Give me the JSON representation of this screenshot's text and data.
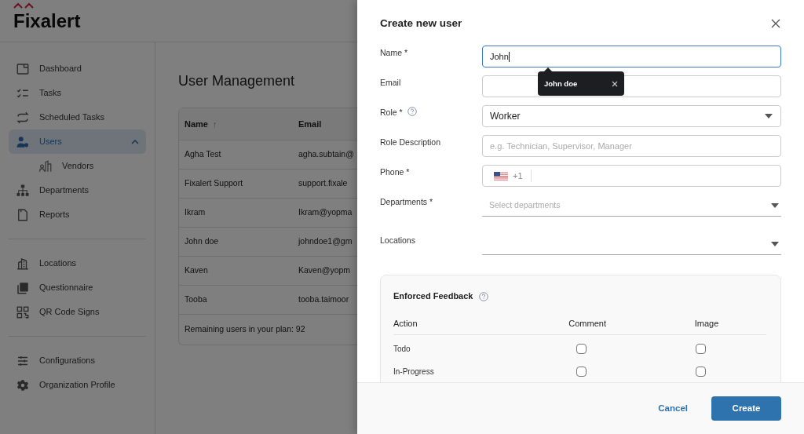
{
  "app": {
    "logo": "Fixalert"
  },
  "sidebar": {
    "items": [
      {
        "label": "Dashboard",
        "selected": false
      },
      {
        "label": "Tasks",
        "selected": false
      },
      {
        "label": "Scheduled Tasks",
        "selected": false
      },
      {
        "label": "Users",
        "selected": true,
        "expanded": true,
        "children": [
          {
            "label": "Vendors",
            "selected": false
          }
        ]
      },
      {
        "label": "Departments",
        "selected": false
      },
      {
        "label": "Reports",
        "selected": false
      },
      {
        "kind": "divider"
      },
      {
        "label": "Locations",
        "selected": false
      },
      {
        "label": "Questionnaire",
        "selected": false
      },
      {
        "label": "QR Code Signs",
        "selected": false
      },
      {
        "kind": "divider"
      },
      {
        "label": "Configurations",
        "selected": false
      },
      {
        "label": "Organization Profile",
        "selected": false
      }
    ]
  },
  "page": {
    "title": "User Management",
    "table": {
      "columns": [
        {
          "label": "Name",
          "sort": "↑"
        },
        {
          "label": "Email"
        }
      ],
      "rows": [
        {
          "name": "Agha Test",
          "email": "agha.subtain@"
        },
        {
          "name": "Fixalert Support",
          "email": "support.fixale"
        },
        {
          "name": "Ikram",
          "email": "Ikram@yopma"
        },
        {
          "name": "John doe",
          "email": "johndoe1@gm"
        },
        {
          "name": "Kaven",
          "email": "Kaven@yopm"
        },
        {
          "name": "Tooba",
          "email": "tooba.taimoor"
        }
      ],
      "footer": "Remaining users in your plan: 92"
    }
  },
  "drawer": {
    "title": "Create new user",
    "fields": [
      {
        "kind": "text",
        "label": "Name *",
        "value": "John",
        "focused": true
      },
      {
        "kind": "text",
        "label": "Email"
      },
      {
        "kind": "select",
        "label": "Role *",
        "help": true,
        "value": "Worker"
      },
      {
        "kind": "text",
        "label": "Role Description",
        "placeholder": "e.g. Technician, Supervisor, Manager"
      },
      {
        "kind": "phone",
        "label": "Phone *",
        "code": "+1"
      },
      {
        "kind": "underline",
        "label": "Departments *",
        "placeholder": "Select departments"
      },
      {
        "kind": "underline",
        "label": "Locations"
      }
    ],
    "suggestion": {
      "text": "John doe"
    },
    "feedback": {
      "title": "Enforced Feedback",
      "columns": [
        "Action",
        "Comment",
        "Image"
      ],
      "rows": [
        {
          "action": "Todo",
          "comment": false,
          "image": false
        },
        {
          "action": "In-Progress",
          "comment": false,
          "image": false
        }
      ]
    },
    "buttons": [
      {
        "label": "Cancel",
        "kind": "text"
      },
      {
        "label": "Create",
        "kind": "primary"
      }
    ]
  }
}
